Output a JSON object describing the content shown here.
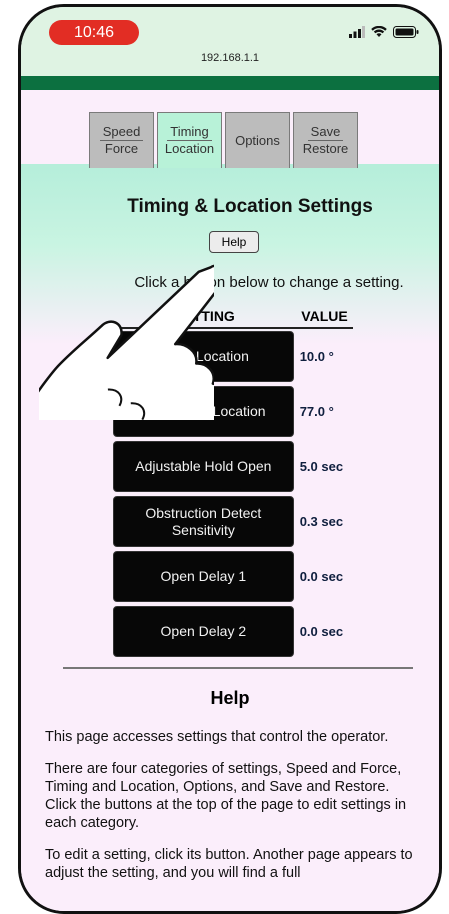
{
  "status_bar": {
    "time": "10:46",
    "url": "192.168.1.1",
    "icons": [
      "signal-icon",
      "wifi-icon",
      "battery-icon"
    ]
  },
  "tabs": [
    {
      "line1": "Speed",
      "line2": "Force",
      "active": false
    },
    {
      "line1": "Timing",
      "line2": "Location",
      "active": true
    },
    {
      "line1": "Options",
      "line2": "",
      "active": false
    },
    {
      "line1": "Save",
      "line2": "Restore",
      "active": false
    }
  ],
  "page": {
    "title": "Timing & Location Settings",
    "help_button": "Help",
    "instruction": "Click a button below to change a setting."
  },
  "settings_table": {
    "headers": {
      "setting": "SETTING",
      "value": "VALUE"
    },
    "rows": [
      {
        "label": "Latch Location",
        "value": "10.0 °"
      },
      {
        "label": "Backcheck Location",
        "value": "77.0 °"
      },
      {
        "label": "Adjustable Hold Open",
        "value": "5.0 sec"
      },
      {
        "label": "Obstruction Detect Sensitivity",
        "value": "0.3 sec"
      },
      {
        "label": "Open Delay 1",
        "value": "0.0 sec"
      },
      {
        "label": "Open Delay 2",
        "value": "0.0 sec"
      }
    ]
  },
  "help": {
    "title": "Help",
    "paragraphs": [
      "This page accesses settings that control the operator.",
      "There are four categories of settings, Speed and Force, Timing and Location, Options, and Save and Restore. Click the buttons at the top of the page to edit settings in each category.",
      "To edit a setting, click its button. Another page appears to adjust the setting, and you will find a full"
    ]
  },
  "colors": {
    "time_pill": "#e22d24",
    "header_bar": "#0c7040",
    "active_tab": "#b8f2d8",
    "page_bg": "#fbeefb"
  }
}
